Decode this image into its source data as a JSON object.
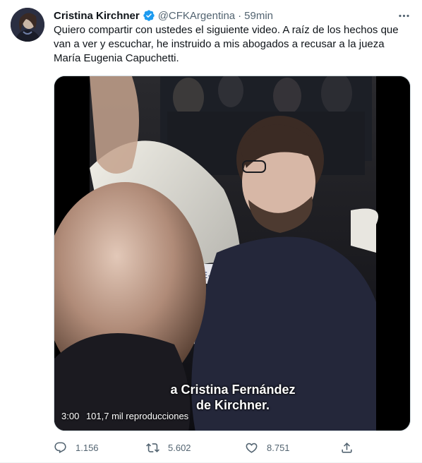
{
  "tweet": {
    "author": {
      "name": "Cristina Kirchner",
      "handle": "@CFKArgentina",
      "verified": true
    },
    "separator": "·",
    "time": "59min",
    "text": "Quiero compartir con ustedes el siguiente video. A raíz de los hechos que van a ver y escuchar, he instruido a mis abogados a recusar a la jueza María Eugenia Capuchetti.",
    "media": {
      "type": "video",
      "caption_line1": "a Cristina Fernández",
      "caption_line2": "de Kirchner.",
      "duration": "3:00",
      "views": "101,7 mil reproducciones"
    },
    "actions": {
      "replies": "1.156",
      "retweets": "5.602",
      "likes": "8.751"
    }
  },
  "icons": {
    "verified": "verified-badge-icon",
    "more": "more-options-icon",
    "reply": "reply-icon",
    "retweet": "retweet-icon",
    "like": "heart-icon",
    "share": "share-icon"
  },
  "colors": {
    "text_primary": "#0f1419",
    "text_secondary": "#536471",
    "verified_blue": "#1d9bf0",
    "divider": "#eff3f4"
  }
}
